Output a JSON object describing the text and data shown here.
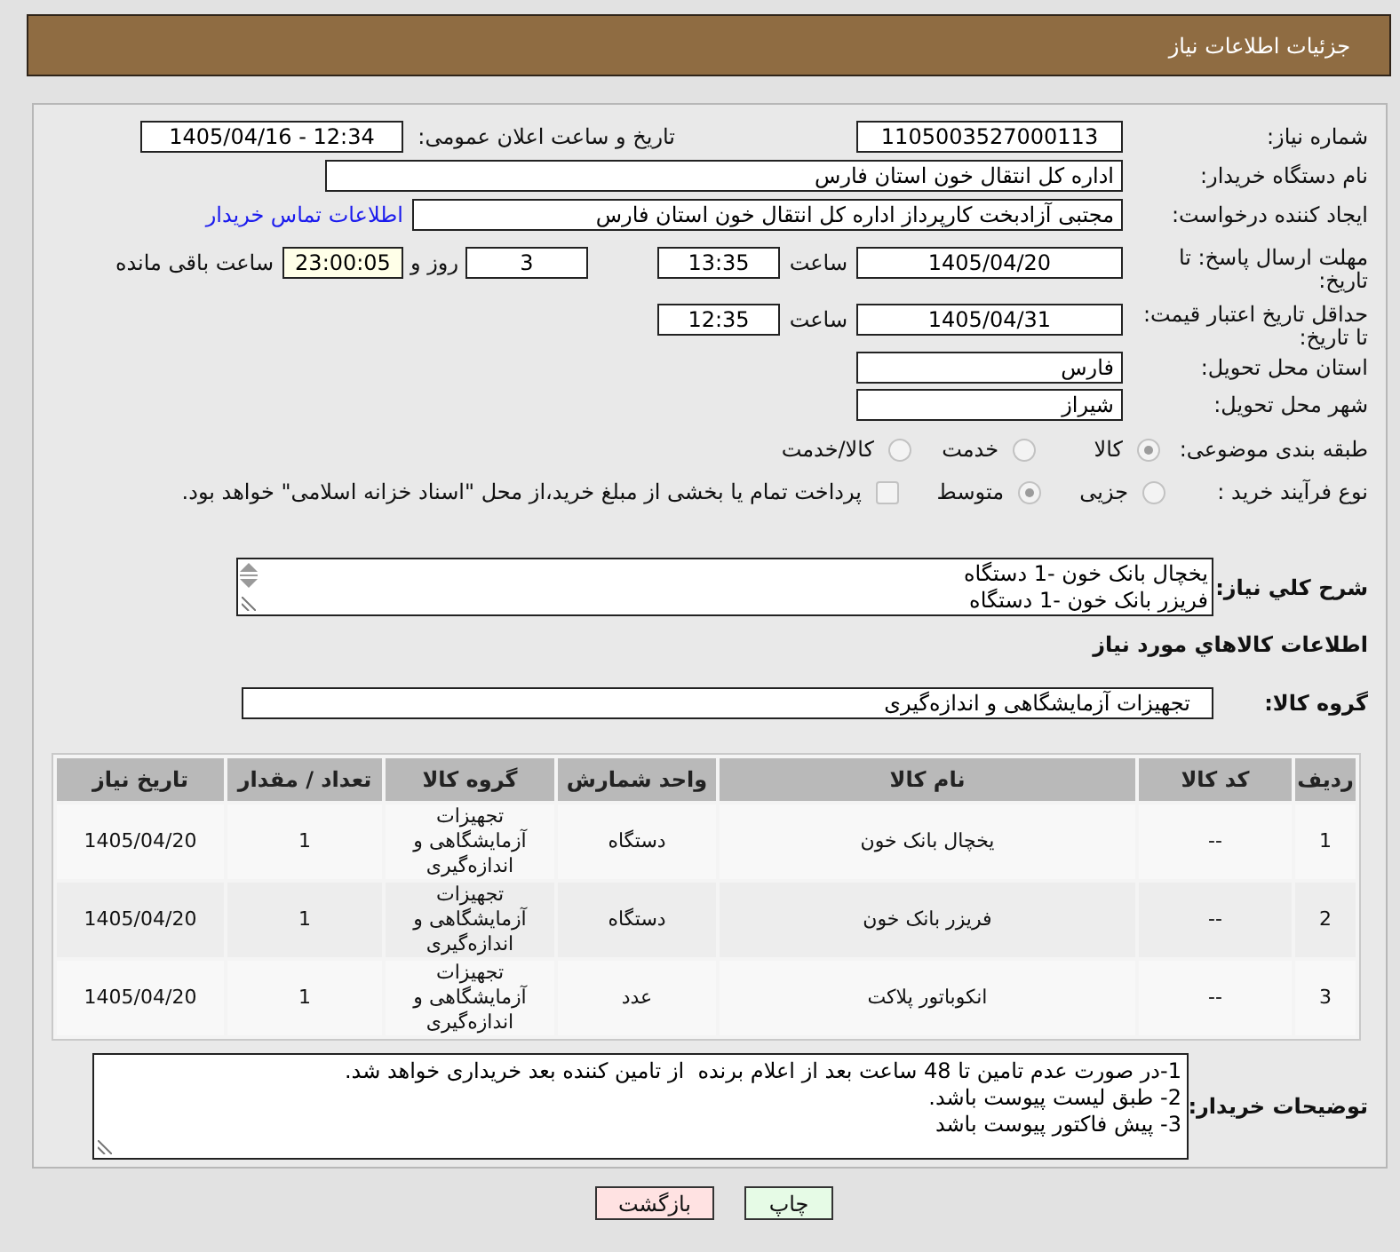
{
  "header": {
    "title": "جزئیات اطلاعات نیاز"
  },
  "need_number": {
    "label": "شماره نیاز:",
    "value": "1105003527000113"
  },
  "announce": {
    "label": "تاریخ و ساعت اعلان عمومی:",
    "value": "1405/04/16 - 12:34"
  },
  "buyer_org": {
    "label": "نام دستگاه خریدار:",
    "value": "اداره کل انتقال خون استان فارس"
  },
  "requester": {
    "label": "ایجاد کننده درخواست:",
    "value": "مجتبی آزادبخت کارپرداز اداره کل انتقال خون استان فارس",
    "link": "اطلاعات تماس خریدار"
  },
  "deadline": {
    "label": "مهلت ارسال پاسخ: تا تاریخ:",
    "date": "1405/04/20",
    "time_label": "ساعت",
    "time": "13:35",
    "days": "3",
    "days_label": "روز و",
    "remaining": "23:00:05",
    "remaining_label": "ساعت باقی مانده"
  },
  "price_validity": {
    "label": "حداقل تاریخ اعتبار قیمت: تا تاریخ:",
    "date": "1405/04/31",
    "time_label": "ساعت",
    "time": "12:35"
  },
  "province": {
    "label": "استان محل تحویل:",
    "value": "فارس"
  },
  "city": {
    "label": "شهر محل تحویل:",
    "value": "شیراز"
  },
  "category": {
    "label": "طبقه بندی موضوعی:",
    "options": [
      {
        "label": "کالا",
        "selected": true
      },
      {
        "label": "خدمت",
        "selected": false
      },
      {
        "label": "کالا/خدمت",
        "selected": false
      }
    ]
  },
  "process": {
    "label": "نوع فرآیند خرید :",
    "options": [
      {
        "label": "جزیی",
        "selected": false
      },
      {
        "label": "متوسط",
        "selected": true
      }
    ],
    "treasury": {
      "label": "پرداخت تمام یا بخشی از مبلغ خرید،از محل \"اسناد خزانه اسلامی\" خواهد بود.",
      "checked": false
    }
  },
  "description": {
    "label": "شرح کلي نیاز:",
    "lines": [
      "یخچال بانک خون -1 دستگاه",
      "فریزر بانک خون -1 دستگاه"
    ]
  },
  "goods_section": {
    "title": "اطلاعات کالاهاي مورد نیاز"
  },
  "goods_group": {
    "label": "گروه کالا:",
    "value": "تجهیزات آزمایشگاهی و اندازه‌گیری"
  },
  "table": {
    "columns": [
      "ردیف",
      "کد کالا",
      "نام کالا",
      "واحد شمارش",
      "گروه کالا",
      "تعداد / مقدار",
      "تاریخ نیاز"
    ],
    "rows": [
      [
        "1",
        "--",
        "یخچال بانک خون",
        "دستگاه",
        "تجهیزات آزمایشگاهی و اندازه‌گیری",
        "1",
        "1405/04/20"
      ],
      [
        "2",
        "--",
        "فریزر بانک خون",
        "دستگاه",
        "تجهیزات آزمایشگاهی و اندازه‌گیری",
        "1",
        "1405/04/20"
      ],
      [
        "3",
        "--",
        "انکوباتور پلاکت",
        "عدد",
        "تجهیزات آزمایشگاهی و اندازه‌گیری",
        "1",
        "1405/04/20"
      ]
    ]
  },
  "buyer_notes": {
    "label": "توضیحات خریدار:",
    "lines": [
      "1-در صورت عدم تامین تا 48 ساعت بعد از اعلام برنده  از تامین کننده بعد خریداری خواهد شد.",
      "2- طبق لیست پیوست باشد.",
      "3- پیش فاکتور پیوست باشد"
    ]
  },
  "buttons": [
    {
      "label": "چاپ",
      "kind": "print"
    },
    {
      "label": "بازگشت",
      "kind": "back"
    }
  ]
}
